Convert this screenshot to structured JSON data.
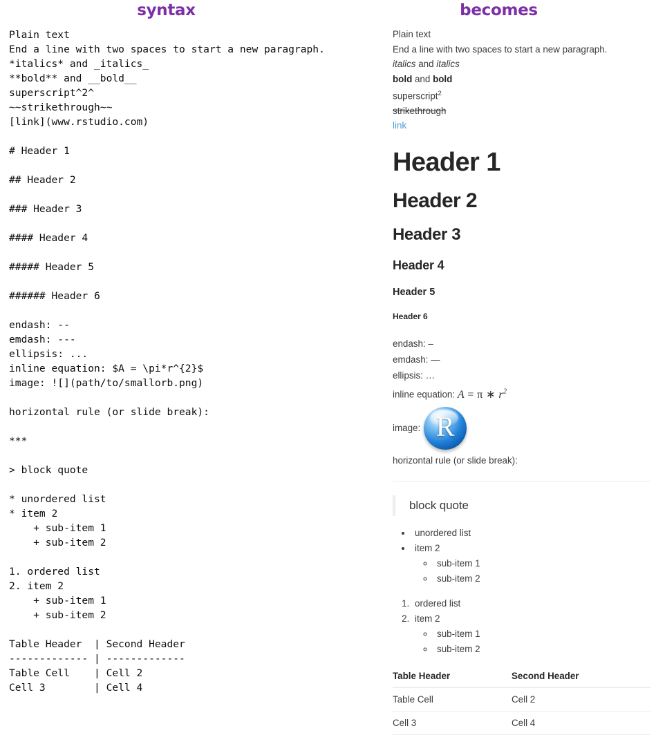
{
  "columns": {
    "left_title": "syntax",
    "right_title": "becomes"
  },
  "colors": {
    "title_purple": "#7d2fa6",
    "link_blue": "#4d9dd4",
    "body_gray": "#3c3c3c",
    "rule_gray": "#ececec",
    "blockquote_bar": "#ededed",
    "orb_blue": "#1f7fd6"
  },
  "syntax": {
    "lines": [
      "Plain text",
      "End a line with two spaces to start a new paragraph.",
      "*italics* and _italics_",
      "**bold** and __bold__",
      "superscript^2^",
      "~~strikethrough~~",
      "[link](www.rstudio.com)",
      "",
      "# Header 1",
      "",
      "## Header 2",
      "",
      "### Header 3",
      "",
      "#### Header 4",
      "",
      "##### Header 5",
      "",
      "###### Header 6",
      "",
      "endash: --",
      "emdash: ---",
      "ellipsis: ...",
      "inline equation: $A = \\pi*r^{2}$",
      "image: ![](path/to/smallorb.png)",
      "",
      "horizontal rule (or slide break):",
      "",
      "***",
      "",
      "> block quote",
      "",
      "* unordered list",
      "* item 2",
      "    + sub-item 1",
      "    + sub-item 2",
      "",
      "1. ordered list",
      "2. item 2",
      "    + sub-item 1",
      "    + sub-item 2",
      "",
      "Table Header  | Second Header",
      "------------- | -------------",
      "Table Cell    | Cell 2",
      "Cell 3        | Cell 4"
    ]
  },
  "becomes": {
    "plain_text": "Plain text",
    "paragraph_line": "End a line with two spaces to start a new paragraph.",
    "italics": {
      "first": "italics",
      "and": " and ",
      "second": "italics"
    },
    "bold": {
      "first": "bold",
      "and": " and ",
      "second": "bold"
    },
    "superscript": {
      "base": "superscript",
      "exponent": "2"
    },
    "strikethrough": "strikethrough",
    "link": "link",
    "headers": {
      "h1": "Header 1",
      "h2": "Header 2",
      "h3": "Header 3",
      "h4": "Header 4",
      "h5": "Header 5",
      "h6": "Header 6"
    },
    "dashes": {
      "endash": "endash: –",
      "emdash": "emdash: —",
      "ellipsis": "ellipsis: …"
    },
    "equation": {
      "label": "inline equation: ",
      "A": "A",
      "equals": " = ",
      "pi": "π",
      "times": " ∗ ",
      "r": "r",
      "exponent": "2"
    },
    "image": {
      "label": "image:",
      "orb_letter": "R"
    },
    "horizontal_rule_label": "horizontal rule (or slide break):",
    "block_quote": "block quote",
    "unordered_list": [
      {
        "text": "unordered list"
      },
      {
        "text": "item 2",
        "children": [
          "sub-item 1",
          "sub-item 2"
        ]
      }
    ],
    "ordered_list": [
      {
        "text": "ordered list"
      },
      {
        "text": "item 2",
        "children": [
          "sub-item 1",
          "sub-item 2"
        ]
      }
    ],
    "table": {
      "headers": [
        "Table Header",
        "Second Header"
      ],
      "rows": [
        [
          "Table Cell",
          "Cell 2"
        ],
        [
          "Cell 3",
          "Cell 4"
        ]
      ]
    }
  }
}
